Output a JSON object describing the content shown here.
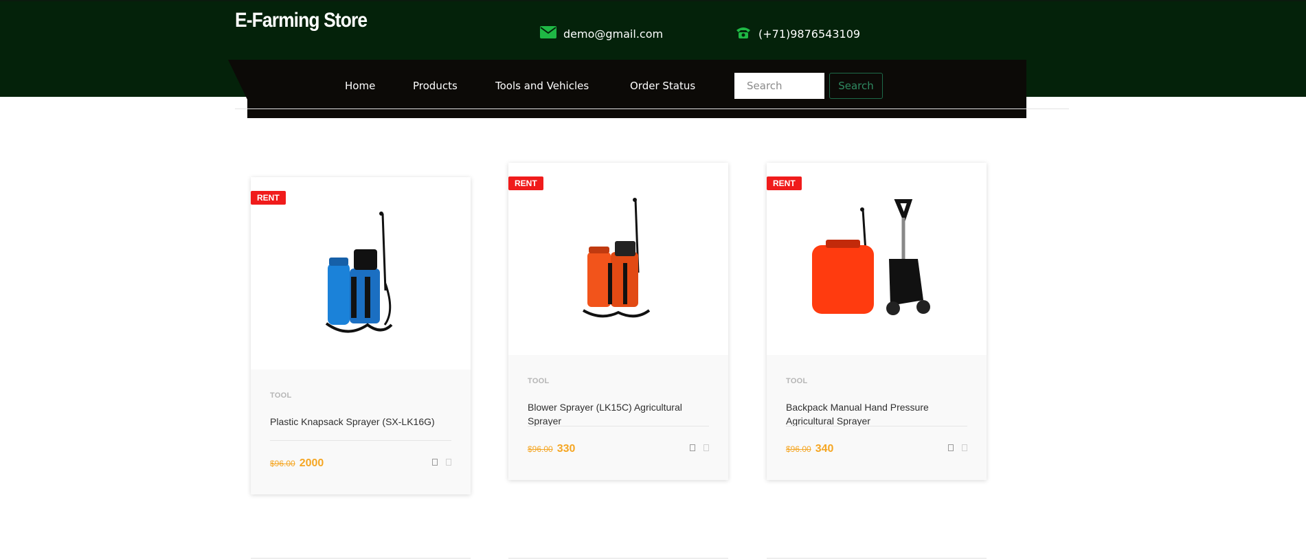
{
  "header": {
    "brand": "E-Farming Store",
    "email": "demo@gmail.com",
    "phone": "(+71)9876543109",
    "email_icon": "envelope-icon",
    "phone_icon": "phone-icon",
    "colors": {
      "topbar": "#04220a",
      "navbar": "#0c0a07",
      "icon_green": "#1fb845"
    }
  },
  "nav": {
    "items": [
      {
        "label": "Home"
      },
      {
        "label": "Products"
      },
      {
        "label": "Tools and Vehicles"
      },
      {
        "label": "Order Status"
      }
    ],
    "search_placeholder": "Search",
    "search_button": "Search"
  },
  "products": [
    {
      "badge": "RENT",
      "category": "TOOL",
      "title": "Plastic Knapsack Sprayer (SX-LK16G)",
      "old_price": "$96.00",
      "price": "2000",
      "image": "blue knapsack sprayer"
    },
    {
      "badge": "RENT",
      "category": "TOOL",
      "title": "Blower Sprayer (LK15C) Agricultural Sprayer",
      "old_price": "$96.00",
      "price": "330",
      "image": "orange knapsack sprayer"
    },
    {
      "badge": "RENT",
      "category": "TOOL",
      "title": "Backpack Manual Hand Pressure Agricultural Sprayer",
      "old_price": "$96.00",
      "price": "340",
      "image": "orange trolley sprayer"
    }
  ]
}
